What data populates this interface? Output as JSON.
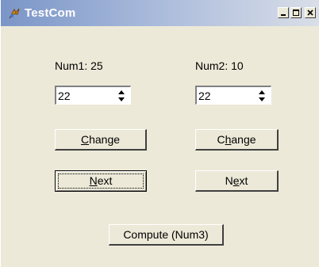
{
  "window": {
    "title": "TestCom",
    "controls": {
      "minimize": "minimize-icon",
      "maximize": "maximize-icon",
      "close": "close-icon"
    }
  },
  "left": {
    "label": "Num1: 25",
    "spin_value": "22",
    "change_pre": "",
    "change_acc": "C",
    "change_post": "hange",
    "next_pre": "",
    "next_acc": "N",
    "next_post": "ext"
  },
  "right": {
    "label": "Num2: 10",
    "spin_value": "22",
    "change_pre": "C",
    "change_acc": "h",
    "change_post": "ange",
    "next_pre": "N",
    "next_acc": "e",
    "next_post": "xt"
  },
  "compute_label": "Compute (Num3)"
}
